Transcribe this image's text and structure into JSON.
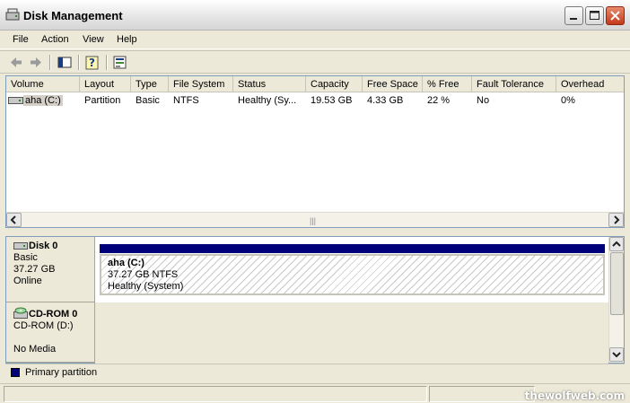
{
  "window": {
    "title": "Disk Management"
  },
  "menu": [
    "File",
    "Action",
    "View",
    "Help"
  ],
  "volume_list": {
    "columns": [
      "Volume",
      "Layout",
      "Type",
      "File System",
      "Status",
      "Capacity",
      "Free Space",
      "% Free",
      "Fault Tolerance",
      "Overhead"
    ],
    "rows": [
      {
        "volume": "aha (C:)",
        "layout": "Partition",
        "type": "Basic",
        "file_system": "NTFS",
        "status": "Healthy (Sy...",
        "capacity": "19.53 GB",
        "free_space": "4.33 GB",
        "pct_free": "22 %",
        "fault_tolerance": "No",
        "overhead": "0%"
      }
    ]
  },
  "disks": [
    {
      "name": "Disk 0",
      "type": "Basic",
      "size": "37.27 GB",
      "state": "Online",
      "partition": {
        "label": "aha  (C:)",
        "detail": "37.27 GB NTFS",
        "status": "Healthy (System)"
      }
    },
    {
      "name": "CD-ROM 0",
      "type": "CD-ROM (D:)",
      "state": "No Media"
    }
  ],
  "legend": {
    "label": "Primary partition",
    "color": "#00007b"
  },
  "watermark": "thewolfweb.com"
}
